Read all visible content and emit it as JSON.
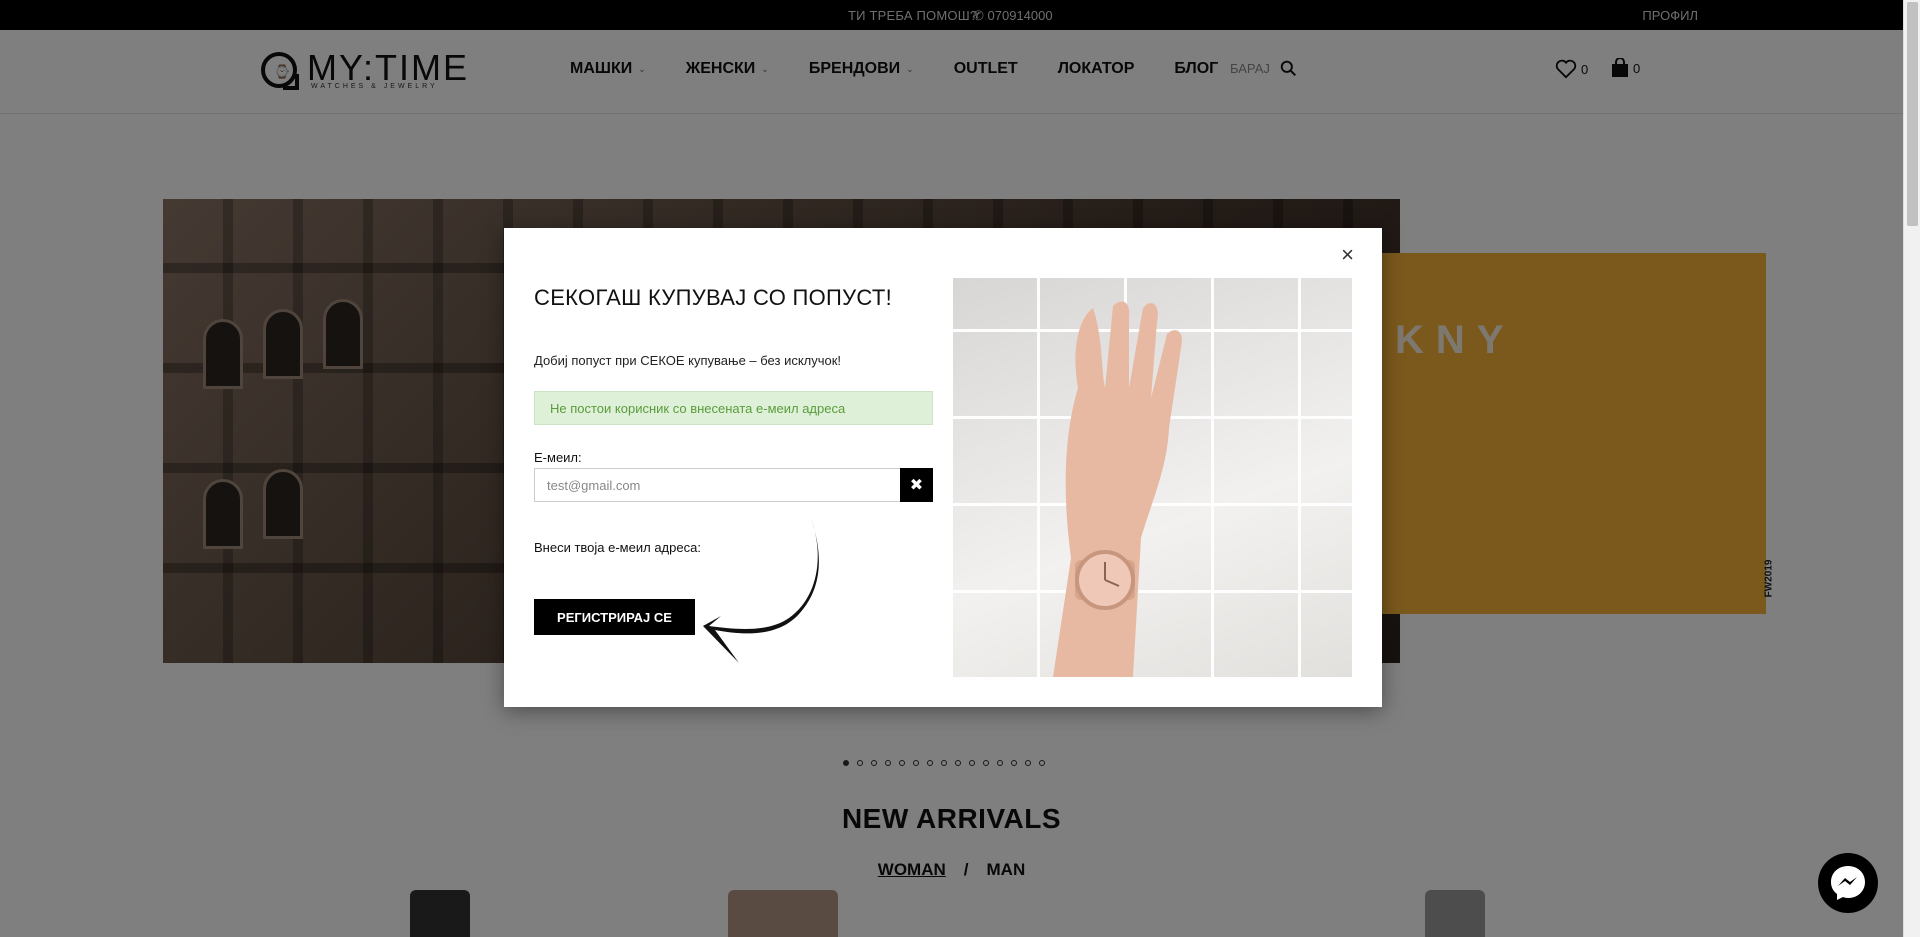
{
  "topbar": {
    "help_label": "ТИ ТРЕБА ПОМОШ?",
    "phone": "070914000",
    "profile_label": "ПРОФИЛ"
  },
  "header": {
    "logo_text": "MY:TIME",
    "logo_tagline": "WATCHES & JEWELRY",
    "nav": [
      {
        "label": "МАШКИ",
        "has_dropdown": true
      },
      {
        "label": "ЖЕНСКИ",
        "has_dropdown": true
      },
      {
        "label": "БРЕНДОВИ",
        "has_dropdown": true
      },
      {
        "label": "OUTLET",
        "has_dropdown": false
      },
      {
        "label": "ЛОКАТОР",
        "has_dropdown": false
      },
      {
        "label": "БЛОГ",
        "has_dropdown": false
      }
    ],
    "search_placeholder": "БАРАЈ",
    "wishlist_count": "0",
    "cart_count": "0"
  },
  "hero": {
    "promo_brand": "KNY",
    "promo_code": "FW2019",
    "promo_color": "#f6b23a",
    "slide_count": 15,
    "active_slide": 1
  },
  "section": {
    "title": "NEW ARRIVALS",
    "filter_woman": "WOMAN",
    "filter_separator": "/",
    "filter_man": "MAN"
  },
  "modal": {
    "title": "СЕКОГАШ КУПУВАЈ СО ПОПУСТ!",
    "subtitle": "Добиј попуст при СЕКОЕ купување – без исклучок!",
    "alert": "Не постои корисник со внесената е-меил адреса",
    "email_label": "Е-меил:",
    "email_placeholder": "test@gmail.com",
    "enter_prompt": "Внеси твоја е-меил адреса:",
    "register_label": "РЕГИСТРИРАЈ СЕ",
    "close_symbol": "×",
    "clear_symbol": "✖"
  }
}
